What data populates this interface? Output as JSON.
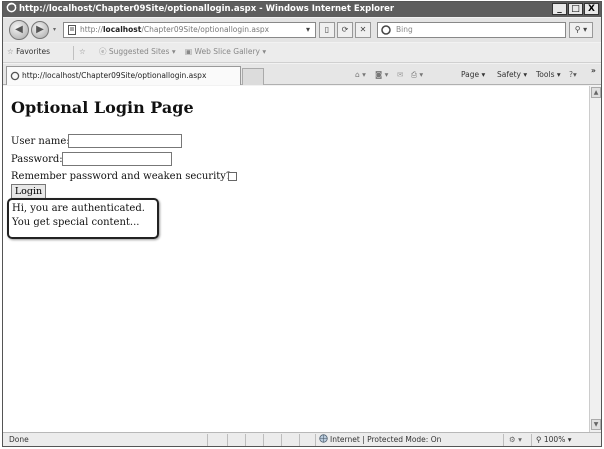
{
  "window": {
    "title": "http://localhost/Chapter09Site/optionallogin.aspx - Windows Internet Explorer",
    "minimize": "_",
    "maximize": "□",
    "close": "X"
  },
  "address_bar": {
    "prefix": "http://",
    "host": "localhost",
    "path": "/Chapter09Site/optionallogin.aspx"
  },
  "search": {
    "placeholder": "Bing"
  },
  "favorites_bar": {
    "favorites": "Favorites",
    "suggested_sites": "Suggested Sites ▾",
    "web_slice_gallery": "Web Slice Gallery ▾"
  },
  "tab": {
    "label": "http://localhost/Chapter09Site/optionallogin.aspx"
  },
  "command_bar": {
    "page": "Page",
    "safety": "Safety",
    "tools": "Tools",
    "more": "»"
  },
  "page": {
    "heading": "Optional Login Page",
    "username_label": "User name:",
    "password_label": "Password:",
    "remember_label": "Remember password and weaken security?:",
    "login_button": "Login",
    "auth_line1": "Hi, you are authenticated.",
    "auth_line2": "You get special content..."
  },
  "status_bar": {
    "status": "Done",
    "zone": "Internet | Protected Mode: On",
    "zoom": "100%"
  }
}
